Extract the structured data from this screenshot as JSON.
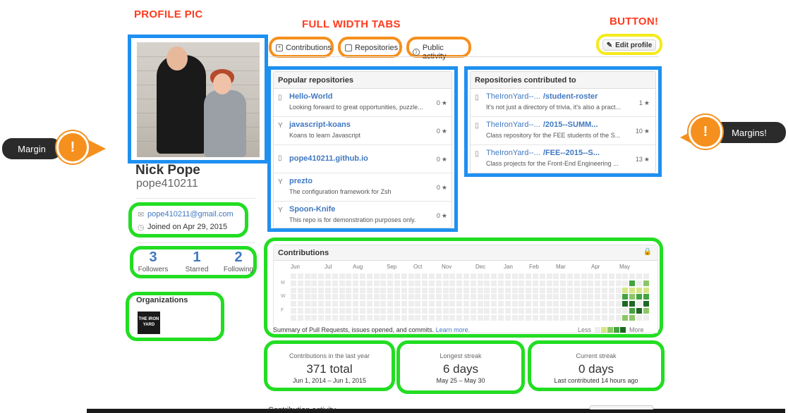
{
  "annotations": {
    "profile_pic": "PROFILE PIC",
    "full_width_tabs": "FULL WIDTH TABS",
    "button": "BUTTON!",
    "margin_left": "Margin",
    "margin_right": "Margins!",
    "exclaim": "!"
  },
  "profile": {
    "name": "Nick Pope",
    "username": "pope410211",
    "email": "pope410211@gmail.com",
    "joined": "Joined on Apr 29, 2015",
    "stats": [
      {
        "value": "3",
        "label": "Followers"
      },
      {
        "value": "1",
        "label": "Starred"
      },
      {
        "value": "2",
        "label": "Following"
      }
    ],
    "organizations_label": "Organizations",
    "org_logo": "THE IRON YARD"
  },
  "tabs": [
    {
      "label": "Contributions",
      "icon": "contributions-icon"
    },
    {
      "label": "Repositories",
      "icon": "repo-icon"
    },
    {
      "label": "Public activity",
      "icon": "rss-icon"
    }
  ],
  "edit_profile_label": "Edit profile",
  "popular": {
    "title": "Popular repositories",
    "repos": [
      {
        "name": "Hello-World",
        "desc": "Looking forward to great opportunities, puzzle...",
        "stars": "0",
        "icon": "repo-icon"
      },
      {
        "name": "javascript-koans",
        "desc": "Koans to learn Javascript",
        "stars": "0",
        "icon": "fork-icon"
      },
      {
        "name": "pope410211.github.io",
        "desc": "",
        "stars": "0",
        "icon": "repo-icon"
      },
      {
        "name": "prezto",
        "desc": "The configuration framework for Zsh",
        "stars": "0",
        "icon": "fork-icon"
      },
      {
        "name": "Spoon-Knife",
        "desc": "This repo is for demonstration purposes only.",
        "stars": "0",
        "icon": "fork-icon"
      }
    ]
  },
  "contributed": {
    "title": "Repositories contributed to",
    "repos": [
      {
        "org": "TheIronYard--...",
        "name": "/student-roster",
        "desc": "It's not just a directory of trivia, it's also a pract...",
        "stars": "1"
      },
      {
        "org": "TheIronYard--...",
        "name": "/2015--SUMM...",
        "desc": "Class repository for the FEE students of the S...",
        "stars": "10"
      },
      {
        "org": "TheIronYard--...",
        "name": "/FEE--2015--S...",
        "desc": "Class projects for the Front-End Engineering ...",
        "stars": "13"
      }
    ]
  },
  "contributions": {
    "title": "Contributions",
    "months": [
      "Jun",
      "Jul",
      "Aug",
      "Sep",
      "Oct",
      "Nov",
      "Dec",
      "Jan",
      "Feb",
      "Mar",
      "Apr",
      "May"
    ],
    "days": [
      "M",
      "W",
      "F"
    ],
    "footer": "Summary of Pull Requests, issues opened, and commits.",
    "learn_more": "Learn more.",
    "less": "Less",
    "more": "More",
    "palette": [
      "#eeeeee",
      "#d6e685",
      "#8cc665",
      "#44a340",
      "#1e6823"
    ]
  },
  "streaks": [
    {
      "title": "Contributions in the last year",
      "big": "371 total",
      "sub": "Jun 1, 2014 – Jun 1, 2015"
    },
    {
      "title": "Longest streak",
      "big": "6 days",
      "sub": "May 25 – May 30"
    },
    {
      "title": "Current streak",
      "big": "0 days",
      "sub": "Last contributed 14 hours ago"
    }
  ],
  "activity_label": "Contribution activity"
}
